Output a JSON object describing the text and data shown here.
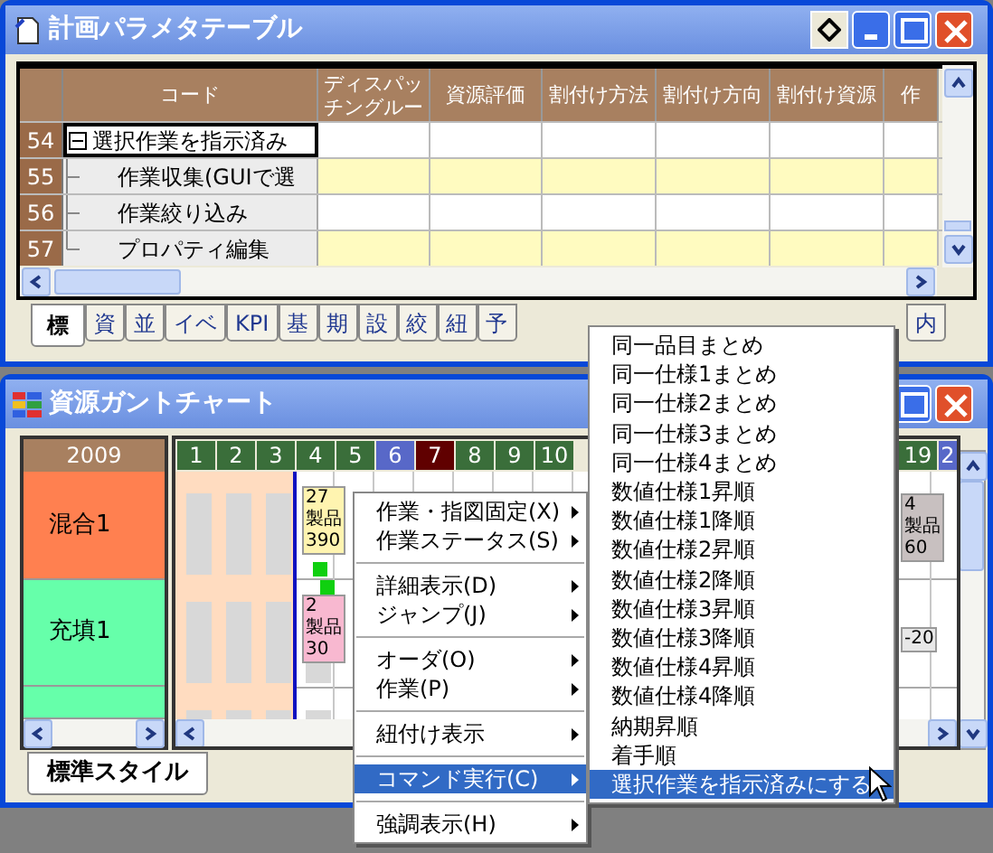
{
  "param_window": {
    "title": "計画パラメタテーブル",
    "columns": [
      "コード",
      "ディスパッチングルー",
      "資源評価",
      "割付け方法",
      "割付け方向",
      "割付け資源",
      "作"
    ],
    "rows": [
      {
        "number": "54",
        "code": "選択作業を指示済み",
        "expanded": true,
        "selected": true,
        "children": [
          {
            "number": "55",
            "code": "作業収集(GUIで選",
            "selected": false
          },
          {
            "number": "56",
            "code": "作業絞り込み",
            "selected": false
          },
          {
            "number": "57",
            "code": "プロパティ編集",
            "selected": false
          }
        ]
      }
    ],
    "tabs": [
      {
        "label": "標",
        "selected": true
      },
      {
        "label": "資",
        "selected": false
      },
      {
        "label": "並",
        "selected": false
      },
      {
        "label": "イベ",
        "selected": false
      },
      {
        "label": "KPI",
        "selected": false
      },
      {
        "label": "基",
        "selected": false
      },
      {
        "label": "期",
        "selected": false
      },
      {
        "label": "設",
        "selected": false
      },
      {
        "label": "絞",
        "selected": false
      },
      {
        "label": "紐",
        "selected": false
      },
      {
        "label": "予",
        "selected": false
      },
      {
        "label": "内",
        "selected": false
      }
    ]
  },
  "gantt_window": {
    "title": "資源ガントチャート",
    "year": "2009",
    "resources": [
      {
        "name": "混合1",
        "color": "#ff8050"
      },
      {
        "name": "充填1",
        "color": "#66ffaa"
      },
      {
        "color": "#66ffaa"
      }
    ],
    "days": [
      {
        "label": "1",
        "color": "#3a6e3a"
      },
      {
        "label": "2",
        "color": "#3a6e3a"
      },
      {
        "label": "3",
        "color": "#3a6e3a"
      },
      {
        "label": "4",
        "color": "#3a6e3a"
      },
      {
        "label": "5",
        "color": "#3a6e3a"
      },
      {
        "label": "6",
        "color": "#5868c8"
      },
      {
        "label": "7",
        "color": "#600000"
      },
      {
        "label": "8",
        "color": "#3a6e3a"
      },
      {
        "label": "9",
        "color": "#3a6e3a"
      },
      {
        "label": "10",
        "color": "#3a6e3a"
      }
    ],
    "right_days": [
      {
        "label": "19",
        "color": "#3a6e3a"
      },
      {
        "label": "2",
        "color": "#5868c8"
      }
    ],
    "bars": [
      {
        "lines": [
          "27",
          "製品",
          "390"
        ],
        "color": "#fff4b0"
      },
      {
        "lines": [
          "2",
          "製品",
          "30"
        ],
        "color": "#f8b8d0"
      },
      {
        "lines": [
          "4",
          "製品",
          "60"
        ],
        "color": "#c8c0c0"
      },
      {
        "lines": [
          "-20"
        ],
        "color": "#e8e8e8"
      }
    ],
    "tabs": [
      {
        "label": "標準スタイル",
        "selected": true
      }
    ]
  },
  "context_menu": [
    {
      "label": "作業・指図固定(X)",
      "separator_above": false,
      "selected": false
    },
    {
      "label": "作業ステータス(S)",
      "separator_above": false,
      "selected": false
    },
    {
      "label": "詳細表示(D)",
      "separator_above": true,
      "selected": false
    },
    {
      "label": "ジャンプ(J)",
      "separator_above": false,
      "selected": false
    },
    {
      "label": "オーダ(O)",
      "separator_above": true,
      "selected": false
    },
    {
      "label": "作業(P)",
      "separator_above": false,
      "selected": false
    },
    {
      "label": "紐付け表示",
      "separator_above": true,
      "selected": false
    },
    {
      "label": "コマンド実行(C)",
      "separator_above": true,
      "selected": true
    },
    {
      "label": "強調表示(H)",
      "separator_above": true,
      "selected": false
    }
  ],
  "submenu": [
    {
      "label": "同一品目まとめ",
      "selected": false
    },
    {
      "label": "同一仕様1まとめ",
      "selected": false
    },
    {
      "label": "同一仕様2まとめ",
      "selected": false
    },
    {
      "label": "同一仕様3まとめ",
      "selected": false
    },
    {
      "label": "同一仕様4まとめ",
      "selected": false
    },
    {
      "label": "数値仕様1昇順",
      "selected": false
    },
    {
      "label": "数値仕様1降順",
      "selected": false
    },
    {
      "label": "数値仕様2昇順",
      "selected": false
    },
    {
      "label": "数値仕様2降順",
      "selected": false
    },
    {
      "label": "数値仕様3昇順",
      "selected": false
    },
    {
      "label": "数値仕様3降順",
      "selected": false
    },
    {
      "label": "数値仕様4昇順",
      "selected": false
    },
    {
      "label": "数値仕様4降順",
      "selected": false
    },
    {
      "label": "納期昇順",
      "selected": false
    },
    {
      "label": "着手順",
      "selected": false
    },
    {
      "label": "選択作業を指示済みにする",
      "selected": true
    }
  ]
}
